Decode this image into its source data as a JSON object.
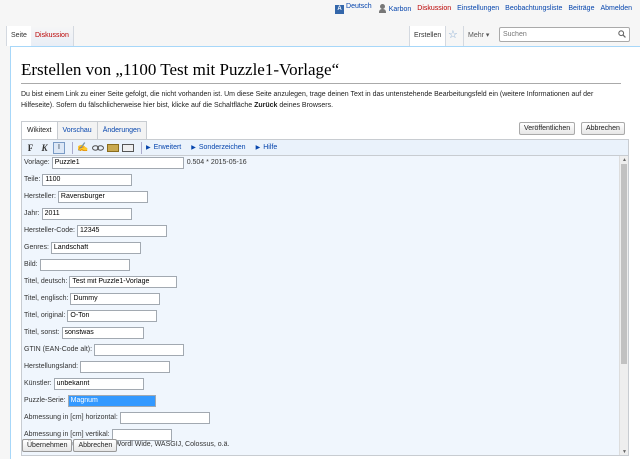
{
  "personal": {
    "lang": "Deutsch",
    "user": "Karbon",
    "discussion": "Diskussion",
    "settings": "Einstellungen",
    "watchlist": "Beobachtungsliste",
    "contributions": "Beiträge",
    "logout": "Abmelden"
  },
  "tabs": {
    "page": "Seite",
    "talk": "Diskussion",
    "create": "Erstellen",
    "more": "Mehr ▾"
  },
  "search": {
    "placeholder": "Suchen"
  },
  "title": "Erstellen von „1100 Test mit Puzzle1-Vorlage“",
  "intro": {
    "before": "Du bist einem Link zu einer Seite gefolgt, die nicht vorhanden ist. Um diese Seite anzulegen, trage deinen Text in das untenstehende Bearbeitungsfeld ein (weitere Informationen auf der Hilfeseite). Sofern du fälschlicherweise hier bist, klicke auf die Schaltfläche ",
    "bold": "Zurück",
    "after": " deines Browsers."
  },
  "edit_tabs": {
    "wikitext": "Wikitext",
    "preview": "Vorschau",
    "changes": "Änderungen"
  },
  "buttons": {
    "publish": "Veröffentlichen",
    "cancel": "Abbrechen",
    "apply": "Übernehmen",
    "abort": "Abbrechen"
  },
  "toolbar": {
    "bold": "F",
    "italic": "K",
    "internal": "I",
    "advanced": "Erweitert",
    "special": "Sonderzeichen",
    "help": "Hilfe"
  },
  "fields": [
    {
      "label": "Vorlage:",
      "value": "Puzzle1",
      "note": "0.504 * 2015-05-16"
    },
    {
      "label": "Teile:",
      "value": "1100"
    },
    {
      "label": "Hersteller:",
      "value": "Ravensburger"
    },
    {
      "label": "Jahr:",
      "value": "2011"
    },
    {
      "label": "Hersteller-Code:",
      "value": "12345"
    },
    {
      "label": "Genres:",
      "value": "Landschaft"
    },
    {
      "label": "Bild:",
      "value": ""
    },
    {
      "label": "Titel, deutsch:",
      "value": "Test mit Puzzle1-Vorlage"
    },
    {
      "label": "Titel, englisch:",
      "value": "Dummy"
    },
    {
      "label": "Titel, original:",
      "value": "O-Ton"
    },
    {
      "label": "Titel, sonst:",
      "value": "sonstwas"
    },
    {
      "label": "GTIN (EAN-Code alt):",
      "value": ""
    },
    {
      "label": "Herstellungsland:",
      "value": ""
    },
    {
      "label": "Künstler:",
      "value": "unbekannt"
    },
    {
      "label": "Puzzle-Serie:",
      "value": "Magnum"
    },
    {
      "label": "Abmessung in [cm] horizontal:",
      "value": ""
    },
    {
      "label": "Abmessung in [cm] vertikal:",
      "value": ""
    },
    {
      "label": "Puzzle gehört zur Serie, z.B. Wordl Wide, WASGIJ, Colossus, o.ä.",
      "value": ""
    }
  ]
}
